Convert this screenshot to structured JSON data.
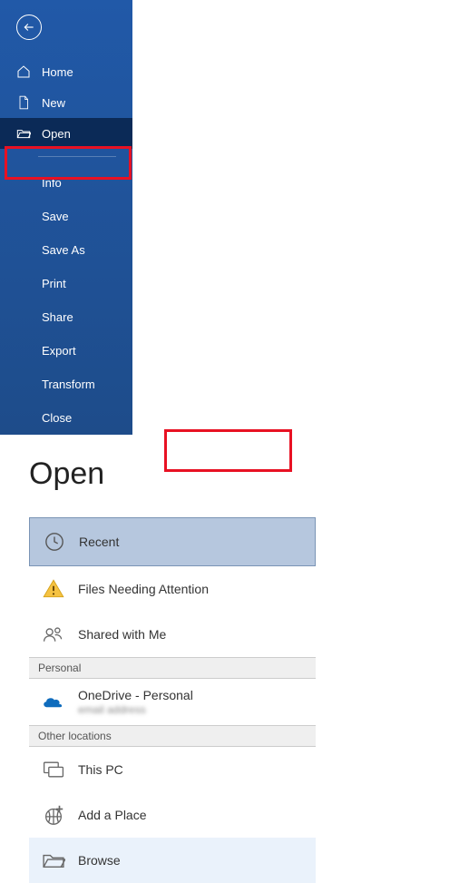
{
  "page": {
    "title": "Open"
  },
  "sidebar": {
    "nav": {
      "home": "Home",
      "new": "New",
      "open": "Open"
    },
    "sub": {
      "info": "Info",
      "save": "Save",
      "saveas": "Save As",
      "print": "Print",
      "share": "Share",
      "export": "Export",
      "transform": "Transform",
      "close": "Close"
    }
  },
  "rail": {
    "recent": "Recent",
    "attention": "Files Needing Attention",
    "shared": "Shared with Me",
    "section_personal": "Personal",
    "onedrive_title": "OneDrive - Personal",
    "onedrive_sub": "email address",
    "section_other": "Other locations",
    "thispc": "This PC",
    "addplace": "Add a Place",
    "browse": "Browse"
  }
}
